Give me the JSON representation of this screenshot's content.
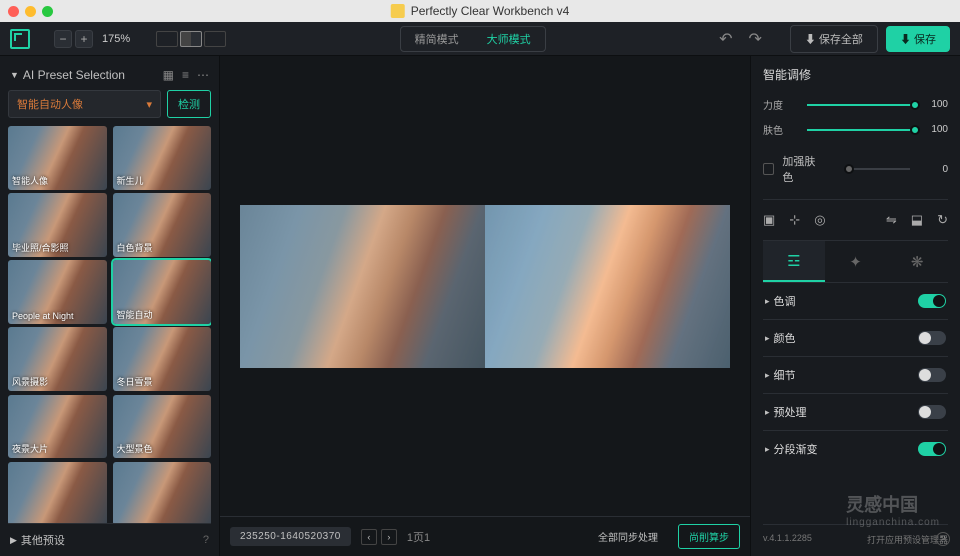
{
  "title": "Perfectly Clear Workbench v4",
  "zoom": "175%",
  "modes": [
    "精简模式",
    "大师模式"
  ],
  "top": {
    "save_all": "⬇ 保存全部",
    "save": "⬇ 保存"
  },
  "left": {
    "panel": "AI Preset Selection",
    "dd": "智能自动人像",
    "detect": "检测",
    "presets": [
      "智能人像",
      "新生儿",
      "毕业照/合影照",
      "白色背景",
      "People at Night",
      "智能自动",
      "风景摄影",
      "冬日雪景",
      "夜景大片",
      "大型景色",
      "",
      ""
    ],
    "other": "其他预设"
  },
  "viewer": {
    "file_id": "235250-1640520370",
    "page": "1页1",
    "sync": "全部同步处理",
    "reset": "尚削算步"
  },
  "right": {
    "head": "智能调修",
    "s1": {
      "label": "力度",
      "val": "100"
    },
    "s2": {
      "label": "肤色",
      "val": "100"
    },
    "chk": {
      "label": "加强肤色",
      "val": "0"
    },
    "acc": [
      "色调",
      "颜色",
      "细节",
      "预处理",
      "分段渐变"
    ],
    "version": "v.4.1.1.2285",
    "manager": "打开应用预设管理器"
  }
}
